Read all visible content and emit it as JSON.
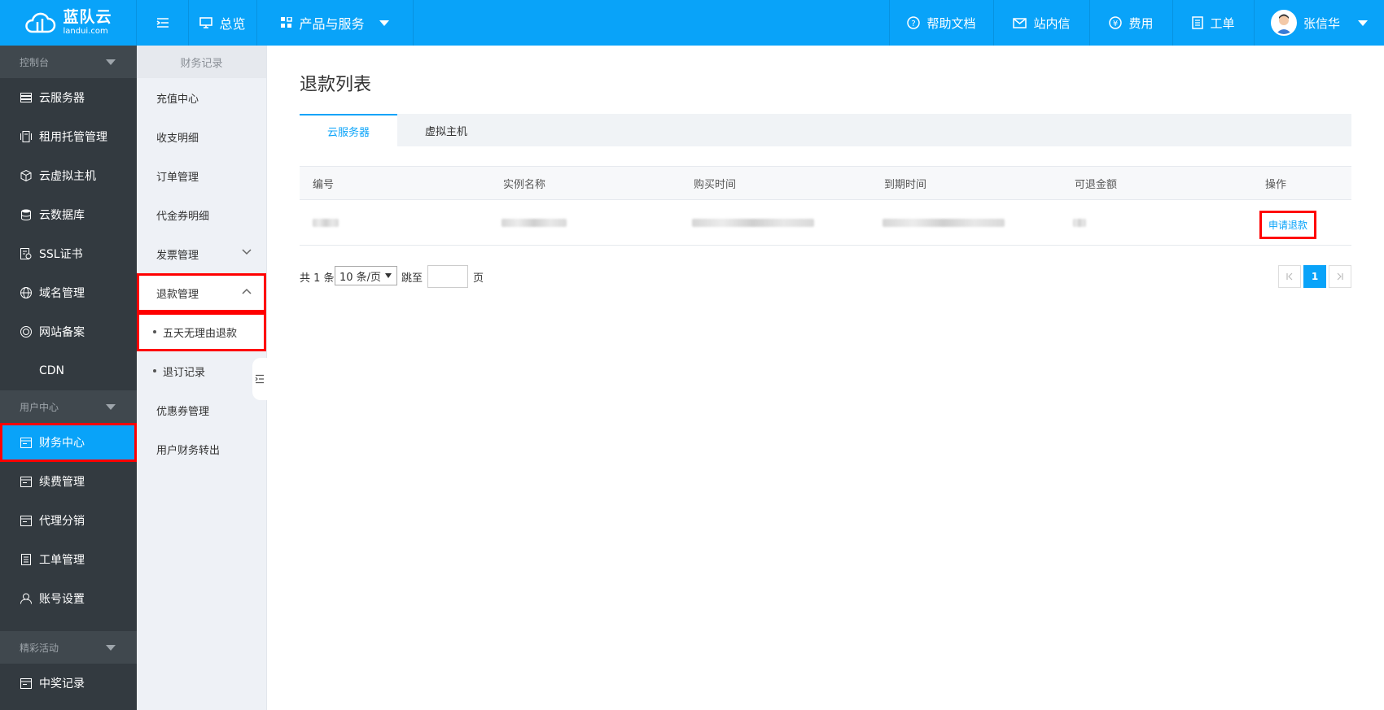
{
  "brand": {
    "name": "蓝队云",
    "domain": "landui.com"
  },
  "topnav": {
    "overview": "总览",
    "products": "产品与服务",
    "help": "帮助文档",
    "messages": "站内信",
    "fees": "费用",
    "tickets": "工单",
    "user": "张信华"
  },
  "sidebar": {
    "groups": [
      {
        "label": "控制台"
      },
      {
        "label": "用户中心"
      },
      {
        "label": "精彩活动"
      }
    ],
    "items": [
      {
        "label": "云服务器",
        "icon": "server-icon"
      },
      {
        "label": "租用托管管理",
        "icon": "rack-icon"
      },
      {
        "label": "云虚拟主机",
        "icon": "cube-icon"
      },
      {
        "label": "云数据库",
        "icon": "database-icon"
      },
      {
        "label": "SSL证书",
        "icon": "certificate-icon"
      },
      {
        "label": "域名管理",
        "icon": "globe-icon"
      },
      {
        "label": "网站备案",
        "icon": "record-icon"
      },
      {
        "label": "CDN",
        "icon": ""
      },
      {
        "label": "财务中心",
        "icon": "finance-icon"
      },
      {
        "label": "续费管理",
        "icon": "renew-icon"
      },
      {
        "label": "代理分销",
        "icon": "agent-icon"
      },
      {
        "label": "工单管理",
        "icon": "ticket-icon"
      },
      {
        "label": "账号设置",
        "icon": "user-icon"
      },
      {
        "label": "中奖记录",
        "icon": "prize-icon"
      }
    ]
  },
  "subnav": {
    "title": "财务记录",
    "items": [
      "充值中心",
      "收支明细",
      "订单管理",
      "代金券明细",
      "发票管理",
      "退款管理"
    ],
    "refund_children": [
      "五天无理由退款",
      "退订记录"
    ],
    "tail": [
      "优惠券管理",
      "用户财务转出"
    ]
  },
  "main": {
    "title": "退款列表",
    "tabs": [
      "云服务器",
      "虚拟主机"
    ],
    "columns": [
      "编号",
      "实例名称",
      "购买时间",
      "到期时间",
      "可退金额",
      "操作"
    ],
    "rows": [
      {
        "action": "申请退款"
      }
    ],
    "pager": {
      "total_prefix": "共 1 条",
      "page_size": "10 条/页",
      "goto_label": "跳至",
      "page_suffix": "页",
      "current": "1"
    }
  },
  "colors": {
    "primary": "#09a3f9",
    "sidebar": "#333a40",
    "highlight": "#ff0000"
  }
}
